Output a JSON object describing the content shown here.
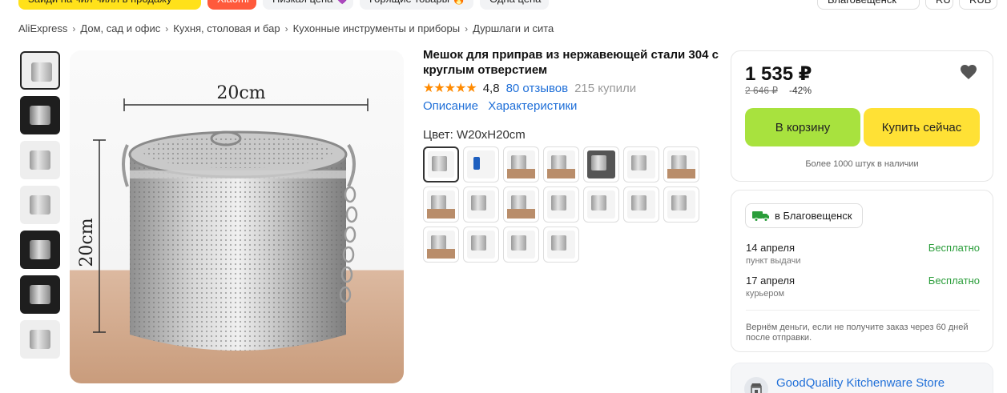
{
  "top_chips": {
    "promo": "Зайди на чил-чилл в продажу",
    "brand": "Xiaomi",
    "low_price": "Низкая цена 💜",
    "hot": "Горящие товары 🔥",
    "one_price": "Одна цена",
    "city": "Благовещенск",
    "lang": "RU",
    "currency": "RUB"
  },
  "breadcrumb": [
    "AliExpress",
    "Дом, сад и офис",
    "Кухня, столовая и бар",
    "Кухонные инструменты и приборы",
    "Дуршлаги и сита"
  ],
  "product": {
    "title": "Мешок для приправ из нержавеющей стали 304 с круглым отверстием",
    "stars": "★★★★★",
    "rating": "4,8",
    "reviews": "80 отзывов",
    "bought": "215 купили",
    "tab_description": "Описание",
    "tab_specs": "Характеристики",
    "color_label": "Цвет: W20xH20cm"
  },
  "image": {
    "dim_width": "20cm",
    "dim_height": "20cm"
  },
  "price_card": {
    "price": "1 535 ₽",
    "old_price": "2 646 ₽",
    "discount": "-42%",
    "add_to_cart": "В корзину",
    "buy_now": "Купить сейчас",
    "stock": "Более 1000 штук в наличии"
  },
  "delivery": {
    "city": "в Благовещенск",
    "options": [
      {
        "date": "14 апреля",
        "method": "пункт выдачи",
        "price": "Бесплатно"
      },
      {
        "date": "17 апреля",
        "method": "курьером",
        "price": "Бесплатно"
      }
    ],
    "refund_note": "Вернём деньги, если не получите заказ через 60 дней после отправки."
  },
  "store": {
    "name": "GoodQuality Kitchenware Store"
  },
  "colors": {
    "accent_green": "#a8e23e",
    "accent_yellow": "#ffe135",
    "link_blue": "#1f6fd8",
    "star_orange": "#ff8a00",
    "free_green": "#2a9d3a"
  }
}
